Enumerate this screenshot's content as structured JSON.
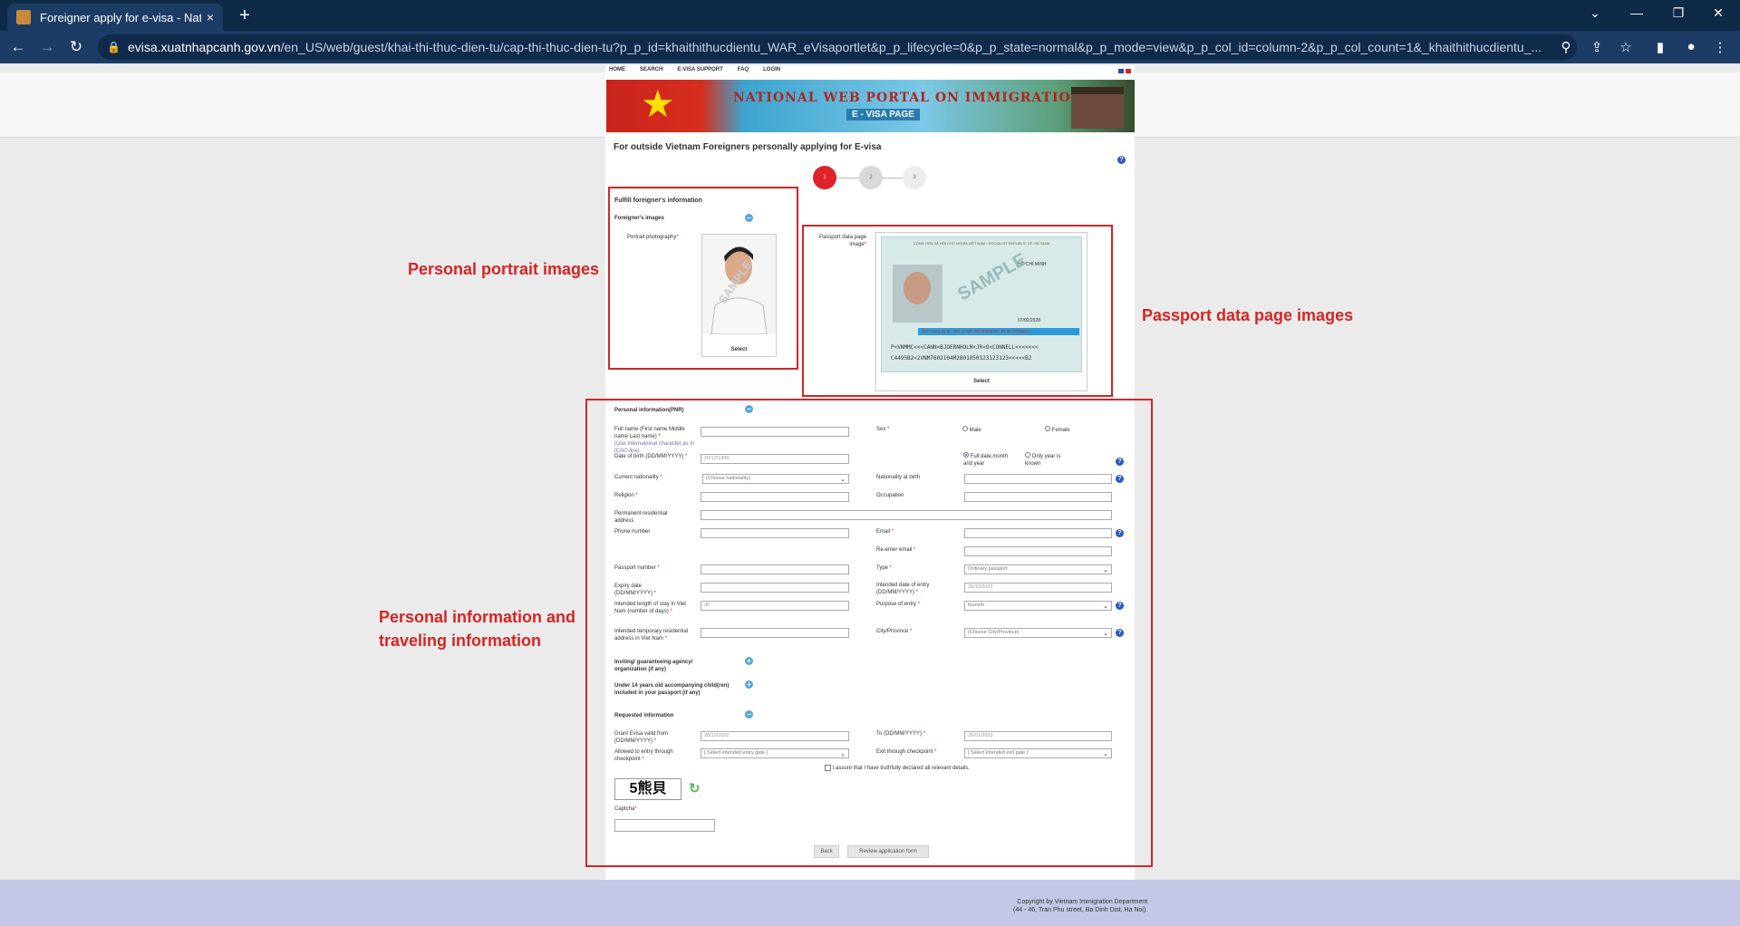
{
  "browser": {
    "tab_title": "Foreigner apply for e-visa - Natic",
    "tab_close": "×",
    "new_tab": "+",
    "url_domain": "evisa.xuatnhapcanh.gov.vn",
    "url_path": "/en_US/web/guest/khai-thi-thuc-dien-tu/cap-thi-thuc-dien-tu?p_p_id=khaithithucdientu_WAR_eVisaportlet&p_p_lifecycle=0&p_p_state=normal&p_p_mode=view&p_p_col_id=column-2&p_p_col_count=1&_khaithithucdientu_..."
  },
  "nav": {
    "items": [
      "HOME",
      "SEARCH",
      "E-VISA SUPPORT",
      "FAQ",
      "LOGIN"
    ]
  },
  "banner": {
    "title": "NATIONAL WEB PORTAL ON IMMIGRATION",
    "subtitle": "E - VISA PAGE"
  },
  "page": {
    "heading": "For outside Vietnam Foreigners personally applying for E-visa",
    "steps": [
      "1",
      "2",
      "3"
    ],
    "active_step": 1
  },
  "images_section": {
    "title": "Fulfill foreigner's information",
    "subtitle": "Foreigner's images",
    "portrait_label": "Portrait photography",
    "passport_label": "Passport data page image",
    "select": "Select",
    "watermark": "SAMPLE",
    "passport_text": {
      "header": "CỘNG HÒA XÃ HỘI CHỦ NGHĨA VIỆT NAM / SOCIALIST REPUBLIC OF VIETNAM",
      "name_bar": "Ảnh mang ký tự - MY CANN SEVENMHOL JR 55 CONNELL",
      "mrz1": "P<VNMMC<<<CANN<BJOERNHOLM<JR<O<CONNELL<<<<<<<",
      "mrz2": "C4495B2<2VNM7602104M2801050123123123<<<<<B2",
      "city": "HỒ CHÍ MINH",
      "date": "07/02/2028"
    }
  },
  "annotations": {
    "portrait": "Personal portrait images",
    "passport": "Passport data page images",
    "personal": "Personal information and traveling information"
  },
  "personal": {
    "title": "Personal information(PNR)",
    "full_name": "Full name (First name Middle name Last name)",
    "full_name_hint": "(Use international character as in ICAO line)",
    "dob": "Date of birth (DD/MM/YYYY)",
    "dob_placeholder": "20/12/1990",
    "sex": "Sex",
    "male": "Male",
    "female": "Female",
    "full_date": "Full date,month and year",
    "only_year": "Only year is known",
    "current_nationality": "Current nationality",
    "choose_nationality": "(Choose nationality)",
    "nationality_birth": "Nationality at birth",
    "religion": "Religion",
    "occupation": "Occupation",
    "permanent_address": "Permanent residential address",
    "phone": "Phone number",
    "email": "Email",
    "reemail": "Re-enter email",
    "passport_number": "Passport number",
    "type": "Type",
    "type_value": "Ordinary passport",
    "expiry": "Expiry date (DD/MM/YYYY)",
    "intended_entry": "Intended date of entry (DD/MM/YYYY)",
    "intended_entry_value": "28/12/2022",
    "length_stay": "Intended length of stay in Viet Nam (number of days)",
    "length_value": "30",
    "purpose": "Purpose of entry",
    "purpose_value": "tourism",
    "temp_address": "Intended temporary residential address in Viet Nam",
    "city": "City/Province",
    "city_value": "(Choose City/Province)",
    "inviting": "Inviting/ guaranteeing agency/ organization (if any)",
    "children": "Under 14 years old accompanying child(ren) included in your passport (if any)",
    "requested": "Requested information",
    "grant_from": "Grant Evisa valid from (DD/MM/YYYY)",
    "grant_from_value": "28/12/2022",
    "to": "To (DD/MM/YYYY)",
    "to_value": "26/01/2023",
    "entry_checkpoint": "Allowed to entry through checkpoint",
    "entry_value": "[ Select intended entry gate ]",
    "exit_checkpoint": "Exit through checkpoint",
    "exit_value": "[ Select intended exit gate ]",
    "assure": "I assure that I have truthfully declared all relevant details.",
    "captcha_text": "5熊貝",
    "captcha": "Captcha",
    "back": "Back",
    "review": "Review application form"
  },
  "footer": {
    "line1": "Copyright by Vietnam Immigration Department",
    "line2": "(44 - 46, Tran Phu street, Ba Dinh Dist, Ha Noi)."
  }
}
